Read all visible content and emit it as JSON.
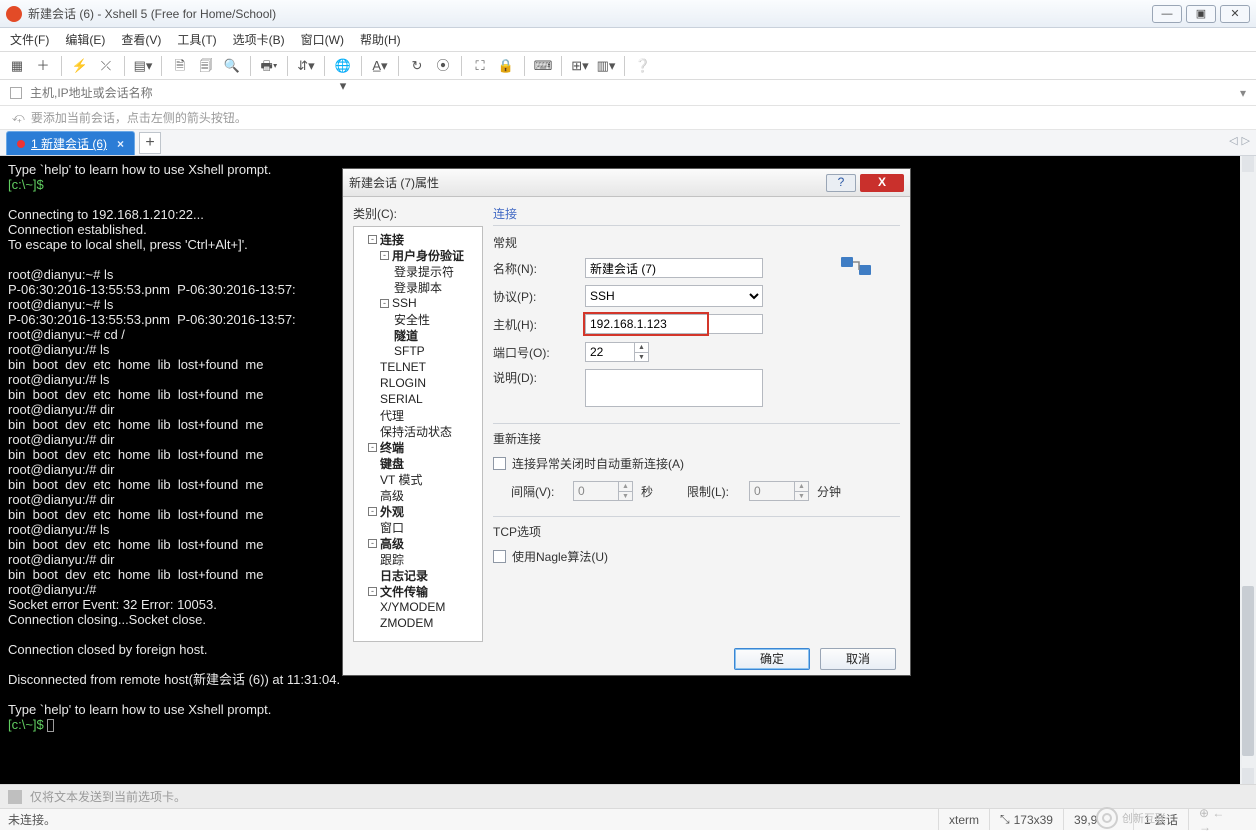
{
  "window": {
    "title": "新建会话 (6) - Xshell 5 (Free for Home/School)"
  },
  "winbtns": {
    "min": "—",
    "max": "▣",
    "close": "✕"
  },
  "menu": [
    "文件(F)",
    "编辑(E)",
    "查看(V)",
    "工具(T)",
    "选项卡(B)",
    "窗口(W)",
    "帮助(H)"
  ],
  "addressbar": {
    "placeholder": "主机,IP地址或会话名称"
  },
  "hint": "要添加当前会话，点击左侧的箭头按钮。",
  "tab": {
    "label": "1 新建会话 (6)",
    "close": "×",
    "add": "+"
  },
  "tabnav": {
    "left": "◁",
    "right": "▷"
  },
  "terminal_lines": [
    "Type `help' to learn how to use Xshell prompt.",
    "[c:\\~]$",
    "",
    "Connecting to 192.168.1.210:22...",
    "Connection established.",
    "To escape to local shell, press 'Ctrl+Alt+]'.",
    "",
    "root@dianyu:~# ls",
    "P-06:30:2016-13:55:53.pnm  P-06:30:2016-13:57:",
    "root@dianyu:~# ls",
    "P-06:30:2016-13:55:53.pnm  P-06:30:2016-13:57:",
    "root@dianyu:~# cd /",
    "root@dianyu:/# ls",
    "bin  boot  dev  etc  home  lib  lost+found  me",
    "root@dianyu:/# ls",
    "bin  boot  dev  etc  home  lib  lost+found  me",
    "root@dianyu:/# dir",
    "bin  boot  dev  etc  home  lib  lost+found  me",
    "root@dianyu:/# dir",
    "bin  boot  dev  etc  home  lib  lost+found  me",
    "root@dianyu:/# dir",
    "bin  boot  dev  etc  home  lib  lost+found  me",
    "root@dianyu:/# dir",
    "bin  boot  dev  etc  home  lib  lost+found  me",
    "root@dianyu:/# ls",
    "bin  boot  dev  etc  home  lib  lost+found  me",
    "root@dianyu:/# dir",
    "bin  boot  dev  etc  home  lib  lost+found  me",
    "root@dianyu:/#",
    "Socket error Event: 32 Error: 10053.",
    "Connection closing...Socket close.",
    "",
    "Connection closed by foreign host.",
    "",
    "Disconnected from remote host(新建会话 (6)) at 11:31:04.",
    "",
    "Type `help' to learn how to use Xshell prompt.",
    "[c:\\~]$ "
  ],
  "prompt_indices": [
    1,
    37
  ],
  "sendbar": "仅将文本发送到当前选项卡。",
  "status": {
    "left": "未连接。",
    "term": "xterm",
    "size": "173x39",
    "cursor": "39,9",
    "sessions": "1 会话"
  },
  "watermark": "创新互联",
  "dialog": {
    "title": "新建会话 (7)属性",
    "help": "?",
    "close": "X",
    "category_label": "类别(C):",
    "tree": [
      {
        "t": "连接",
        "l": 0,
        "b": 1,
        "sq": "-"
      },
      {
        "t": "用户身份验证",
        "l": 1,
        "b": 1,
        "sq": "-"
      },
      {
        "t": "登录提示符",
        "l": 2
      },
      {
        "t": "登录脚本",
        "l": 2
      },
      {
        "t": "SSH",
        "l": 1,
        "sq": "-"
      },
      {
        "t": "安全性",
        "l": 2
      },
      {
        "t": "隧道",
        "l": 2,
        "b": 1
      },
      {
        "t": "SFTP",
        "l": 2
      },
      {
        "t": "TELNET",
        "l": 1
      },
      {
        "t": "RLOGIN",
        "l": 1
      },
      {
        "t": "SERIAL",
        "l": 1
      },
      {
        "t": "代理",
        "l": 1
      },
      {
        "t": "保持活动状态",
        "l": 1
      },
      {
        "t": "终端",
        "l": 0,
        "b": 1,
        "sq": "-"
      },
      {
        "t": "键盘",
        "l": 1,
        "b": 1
      },
      {
        "t": "VT 模式",
        "l": 1
      },
      {
        "t": "高级",
        "l": 1
      },
      {
        "t": "外观",
        "l": 0,
        "b": 1,
        "sq": "-"
      },
      {
        "t": "窗口",
        "l": 1
      },
      {
        "t": "高级",
        "l": 0,
        "b": 1,
        "sq": "-"
      },
      {
        "t": "跟踪",
        "l": 1
      },
      {
        "t": "日志记录",
        "l": 1,
        "b": 1
      },
      {
        "t": "文件传输",
        "l": 0,
        "b": 1,
        "sq": "-"
      },
      {
        "t": "X/YMODEM",
        "l": 1
      },
      {
        "t": "ZMODEM",
        "l": 1
      }
    ],
    "panel": {
      "section_conn": "连接",
      "section_general": "常规",
      "name_label": "名称(N):",
      "name_value": "新建会话 (7)",
      "proto_label": "协议(P):",
      "proto_value": "SSH",
      "host_label": "主机(H):",
      "host_value": "192.168.1.123",
      "port_label": "端口号(O):",
      "port_value": "22",
      "desc_label": "说明(D):",
      "section_reconnect": "重新连接",
      "auto_reconnect": "连接异常关闭时自动重新连接(A)",
      "interval_label": "间隔(V):",
      "interval_value": "0",
      "interval_unit": "秒",
      "limit_label": "限制(L):",
      "limit_value": "0",
      "limit_unit": "分钟",
      "section_tcp": "TCP选项",
      "nagle": "使用Nagle算法(U)",
      "ok": "确定",
      "cancel": "取消"
    }
  }
}
